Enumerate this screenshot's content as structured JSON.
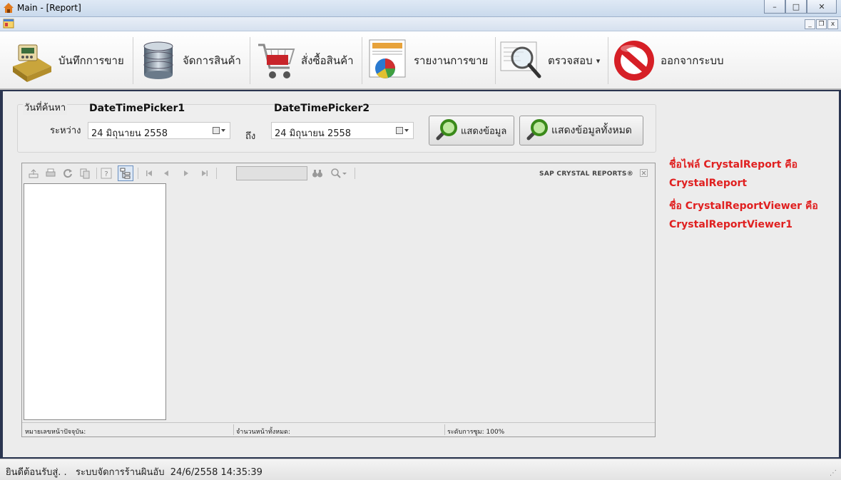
{
  "window": {
    "title": "Main - [Report]",
    "controls": {
      "minimize": "–",
      "maximize": "□",
      "close": "✕"
    }
  },
  "mdi": {
    "controls": {
      "minimize": "_",
      "restore": "❐",
      "close": "x"
    }
  },
  "toolbar": {
    "items": [
      {
        "label": "บันทึกการขาย",
        "icon": "cash-register-icon"
      },
      {
        "label": "จัดการสินค้า",
        "icon": "database-icon"
      },
      {
        "label": "สั่งซื้อสินค้า",
        "icon": "shopping-cart-icon"
      },
      {
        "label": "รายงานการขาย",
        "icon": "report-chart-icon"
      },
      {
        "label": "ตรวจสอบ",
        "icon": "magnifier-document-icon",
        "dropdown": "▾"
      },
      {
        "label": "ออกจากระบบ",
        "icon": "no-entry-icon"
      }
    ]
  },
  "search": {
    "title": "วันที่ค้นหา",
    "between_label": "ระหว่าง",
    "to_label": "ถึง",
    "picker1": {
      "caption": "DateTimePicker1",
      "value": "24  มิถุนายน    2558"
    },
    "picker2": {
      "caption": "DateTimePicker2",
      "value": "24  มิถุนายน    2558"
    },
    "show_button": "แสดงข้อมูล",
    "show_all_button": "แสดงข้อมูลทั้งหมด"
  },
  "viewer": {
    "brand": "SAP CRYSTAL REPORTS®",
    "status": {
      "current_page": "หมายเลขหน้าปัจจุบัน:",
      "total_pages": "จำนวนหน้าทั้งหมด:",
      "zoom": "ระดับการซูม: 100%"
    }
  },
  "notes": [
    "ชื่อไฟล์ CrystalReport คือ",
    "CrystalReport",
    "ชื่อ CrystalReportViewer   คือ",
    "CrystalReportViewer1"
  ],
  "statusbar": {
    "text": "ยินดีต้อนรับสู่. .   ระบบจัดการร้านผินอับ  24/6/2558 14:35:39"
  },
  "colors": {
    "accent_red": "#e02020",
    "title_gradient": "#c9d9ec"
  }
}
